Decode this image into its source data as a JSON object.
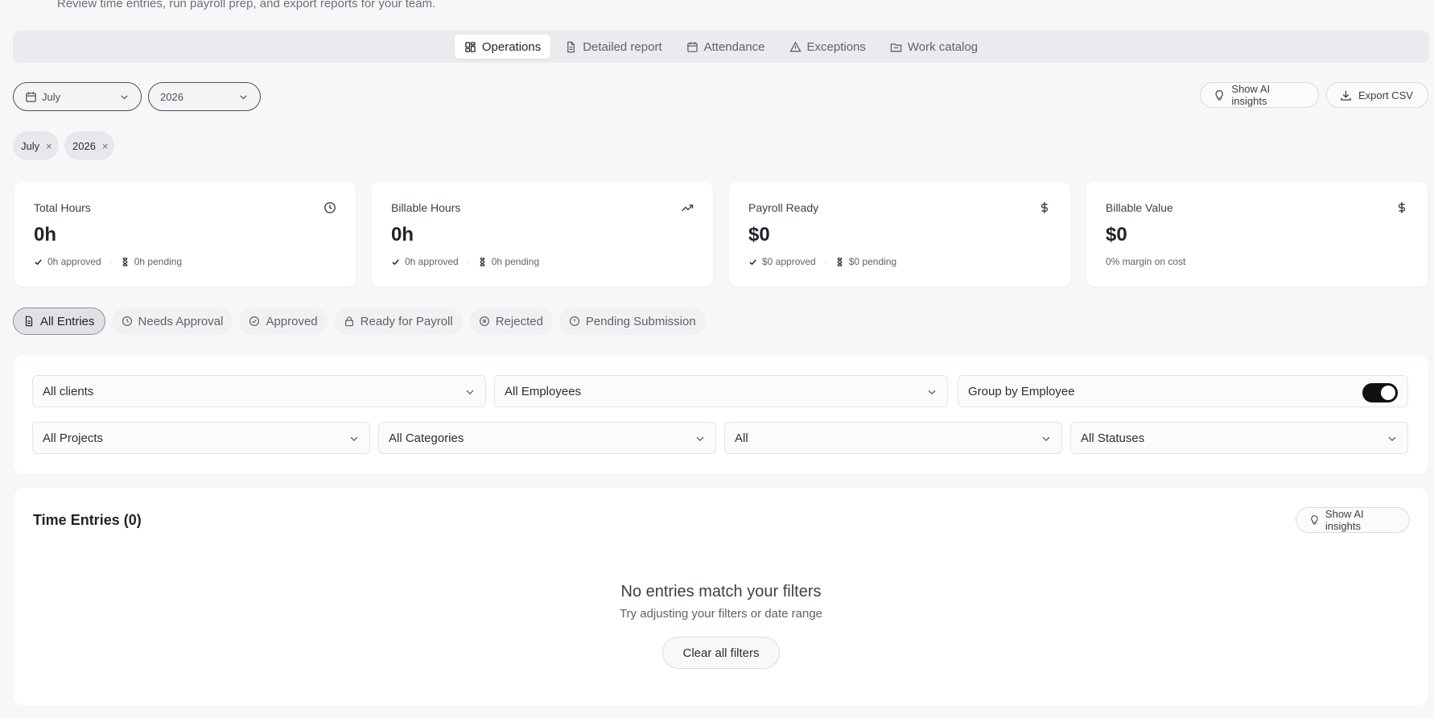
{
  "header": {
    "subtitle": "Review time entries, run payroll prep, and export reports for your team."
  },
  "tabs": [
    {
      "label": "Operations",
      "icon": "grid-icon",
      "active": true
    },
    {
      "label": "Detailed report",
      "icon": "document-icon"
    },
    {
      "label": "Attendance",
      "icon": "calendar-icon"
    },
    {
      "label": "Exceptions",
      "icon": "warning-icon"
    },
    {
      "label": "Work catalog",
      "icon": "folder-icon"
    }
  ],
  "period": {
    "month": "July",
    "year": "2026"
  },
  "actions": {
    "show_ai_insights": "Show AI insights",
    "export_csv": "Export CSV"
  },
  "chips": [
    {
      "label": "July",
      "remove": "×"
    },
    {
      "label": "2026",
      "remove": "×"
    }
  ],
  "stats": [
    {
      "title": "Total Hours",
      "value": "0h",
      "approved": "0h approved",
      "pending": "0h pending",
      "icon": "clock-icon"
    },
    {
      "title": "Billable Hours",
      "value": "0h",
      "approved": "0h approved",
      "pending": "0h pending",
      "icon": "trending-up-icon"
    },
    {
      "title": "Payroll Ready",
      "value": "$0",
      "approved": "$0 approved",
      "pending": "$0 pending",
      "icon": "dollar-icon"
    },
    {
      "title": "Billable Value",
      "value": "$0",
      "note": "0% margin on cost",
      "icon": "dollar-icon"
    }
  ],
  "status_tabs": [
    {
      "label": "All Entries",
      "active": true,
      "icon": "file-icon"
    },
    {
      "label": "Needs Approval",
      "icon": "clock-icon"
    },
    {
      "label": "Approved",
      "icon": "check-circle-icon"
    },
    {
      "label": "Ready for Payroll",
      "icon": "lock-icon"
    },
    {
      "label": "Rejected",
      "icon": "x-circle-icon"
    },
    {
      "label": "Pending Submission",
      "icon": "alert-circle-icon"
    }
  ],
  "filters": {
    "clients": "All clients",
    "employees": "All Employees",
    "group_by_label": "Group by Employee",
    "group_by_on": true,
    "projects": "All Projects",
    "categories": "All Categories",
    "billable": "All",
    "statuses": "All Statuses"
  },
  "entries": {
    "title": "Time Entries (0)",
    "show_ai_insights": "Show AI insights",
    "empty_title": "No entries match your filters",
    "empty_sub": "Try adjusting your filters or date range",
    "clear_filters": "Clear all filters"
  }
}
